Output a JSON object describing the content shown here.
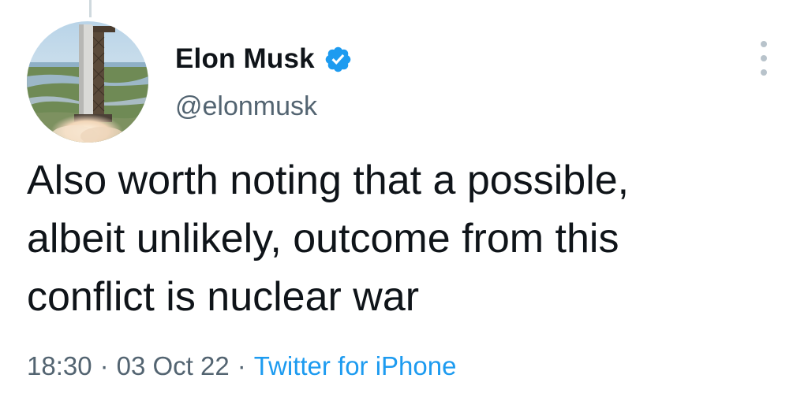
{
  "author": {
    "display_name": "Elon Musk",
    "handle": "@elonmusk",
    "verified": true,
    "avatar": "rocket-launch-photo"
  },
  "tweet": {
    "text": "Also worth noting that a possible,\nalbeit unlikely, outcome from this\nconflict is nuclear war",
    "time": "18:30",
    "date": "03 Oct 22",
    "separator": "·",
    "source": "Twitter for iPhone"
  },
  "icons": {
    "verified": "verified-badge-icon",
    "more": "more-vertical-icon"
  },
  "colors": {
    "link": "#1d9bf0",
    "secondary_text": "#536471",
    "primary_text": "#0f1419",
    "verified": "#1d9bf0"
  }
}
